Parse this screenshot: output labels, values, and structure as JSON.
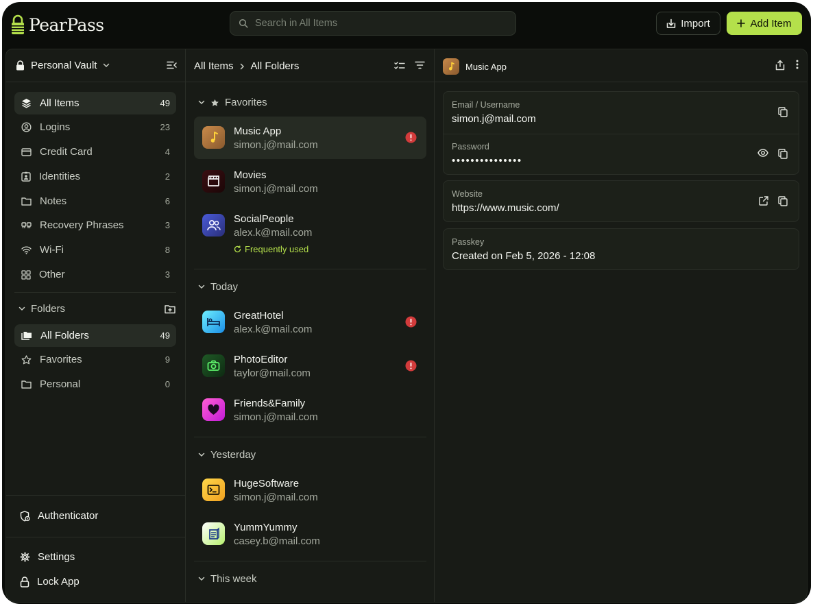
{
  "app": {
    "name": "PearPass",
    "search_placeholder": "Search in All Items",
    "import_label": "Import",
    "add_label": "Add Item",
    "accent": "#b4e04b"
  },
  "sidebar": {
    "vault_name": "Personal Vault",
    "categories": [
      {
        "label": "All Items",
        "count": "49",
        "icon": "layers-icon",
        "active": true
      },
      {
        "label": "Logins",
        "count": "23",
        "icon": "user-circle-icon",
        "active": false
      },
      {
        "label": "Credit Card",
        "count": "4",
        "icon": "credit-card-icon",
        "active": false
      },
      {
        "label": "Identities",
        "count": "2",
        "icon": "id-badge-icon",
        "active": false
      },
      {
        "label": "Notes",
        "count": "6",
        "icon": "folder-note-icon",
        "active": false
      },
      {
        "label": "Recovery Phrases",
        "count": "3",
        "icon": "phrase-icon",
        "active": false
      },
      {
        "label": "Wi-Fi",
        "count": "8",
        "icon": "wifi-icon",
        "active": false
      },
      {
        "label": "Other",
        "count": "3",
        "icon": "grid-icon",
        "active": false
      }
    ],
    "folders_label": "Folders",
    "folders": [
      {
        "label": "All Folders",
        "count": "49",
        "icon": "folders-icon",
        "active": true
      },
      {
        "label": "Favorites",
        "count": "9",
        "icon": "star-icon",
        "active": false
      },
      {
        "label": "Personal",
        "count": "0",
        "icon": "folder-icon",
        "active": false
      }
    ],
    "authenticator_label": "Authenticator",
    "settings_label": "Settings",
    "lock_label": "Lock App"
  },
  "list": {
    "breadcrumb": [
      "All Items",
      "All Folders"
    ],
    "groups": [
      {
        "title": "Favorites",
        "items": [
          {
            "title": "Music App",
            "subtitle": "simon.j@mail.com",
            "warning": true,
            "selected": true,
            "icon": "music-note-icon"
          },
          {
            "title": "Movies",
            "subtitle": "simon.j@mail.com",
            "warning": false,
            "selected": false,
            "icon": "clapperboard-icon"
          },
          {
            "title": "SocialPeople",
            "subtitle": "alex.k@mail.com",
            "warning": false,
            "selected": false,
            "icon": "people-icon",
            "badge": "Frequently used"
          }
        ]
      },
      {
        "title": "Today",
        "items": [
          {
            "title": "GreatHotel",
            "subtitle": "alex.k@mail.com",
            "warning": true,
            "selected": false,
            "icon": "bed-icon"
          },
          {
            "title": "PhotoEditor",
            "subtitle": "taylor@mail.com",
            "warning": true,
            "selected": false,
            "icon": "camera-icon"
          },
          {
            "title": "Friends&Family",
            "subtitle": "simon.j@mail.com",
            "warning": false,
            "selected": false,
            "icon": "heart-icon"
          }
        ]
      },
      {
        "title": "Yesterday",
        "items": [
          {
            "title": "HugeSoftware",
            "subtitle": "simon.j@mail.com",
            "warning": false,
            "selected": false,
            "icon": "terminal-icon"
          },
          {
            "title": "YummYummy",
            "subtitle": "casey.b@mail.com",
            "warning": false,
            "selected": false,
            "icon": "menu-card-icon"
          }
        ]
      },
      {
        "title": "This week",
        "items": []
      }
    ]
  },
  "detail": {
    "title": "Music App",
    "fields": {
      "email_label": "Email / Username",
      "email_value": "simon.j@mail.com",
      "password_label": "Password",
      "password_value": "•••••••••••••••",
      "website_label": "Website",
      "website_value": "https://www.music.com/",
      "passkey_label": "Passkey",
      "passkey_value": "Created on Feb 5, 2026 - 12:08"
    }
  }
}
